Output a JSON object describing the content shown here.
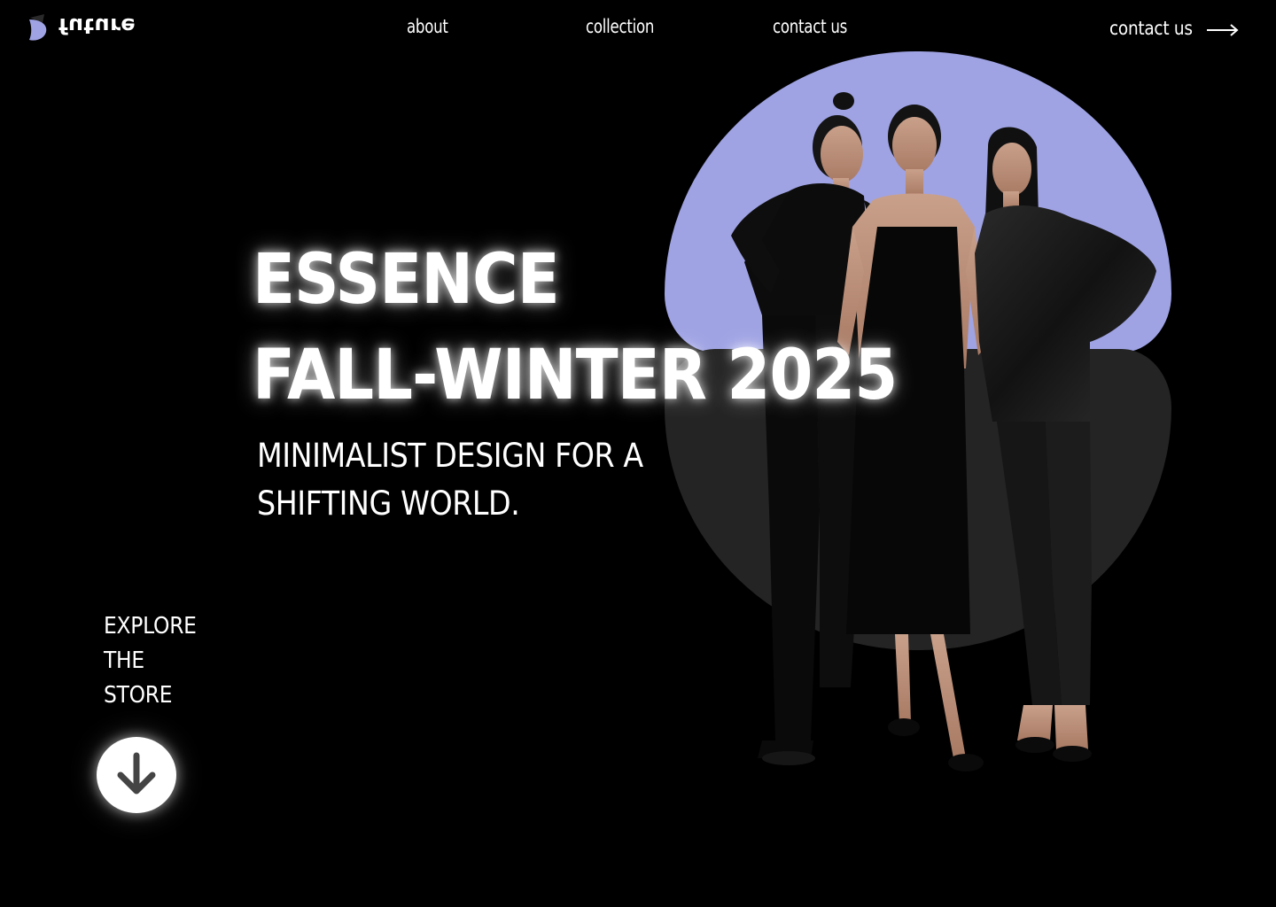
{
  "header": {
    "logo_text": "future",
    "nav": [
      {
        "label": "about"
      },
      {
        "label": "collection"
      },
      {
        "label": "contact us"
      }
    ],
    "cta": {
      "label": "contact us",
      "icon": "arrow-right-icon"
    }
  },
  "hero": {
    "title_lines": [
      "ESSENCE",
      "FALL-WINTER 2025"
    ],
    "subtitle_lines": [
      "MINIMALIST DESIGN FOR A",
      "SHIFTING WORLD."
    ],
    "image": "three-models-in-black-outfits"
  },
  "explore": {
    "label_lines": [
      "EXPLORE",
      "THE",
      "STORE"
    ],
    "icon": "arrow-down-icon"
  },
  "colors": {
    "background": "#000000",
    "text": "#ffffff",
    "accent_lavender": "#9fa3e3",
    "shape_gray": "#242424"
  }
}
